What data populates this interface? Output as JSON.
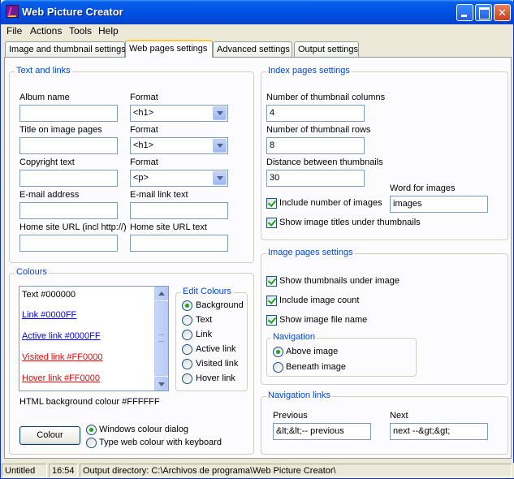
{
  "window": {
    "title": "Web Picture Creator",
    "icon": "app-icon",
    "controls": [
      "minimize-icon",
      "maximize-icon",
      "close-icon"
    ]
  },
  "menu": [
    "File",
    "Actions",
    "Tools",
    "Help"
  ],
  "tabs": [
    {
      "label": "Image and thumbnail settings",
      "active": false
    },
    {
      "label": "Web pages settings",
      "active": true
    },
    {
      "label": "Advanced settings",
      "active": false
    },
    {
      "label": "Output settings",
      "active": false
    }
  ],
  "text_links": {
    "title": "Text and links",
    "album_name_label": "Album name",
    "album_name_value": "",
    "format_label": "Format",
    "album_format": "<h1>",
    "title_label": "Title on image pages",
    "title_value": "",
    "title_format": "<h1>",
    "copyright_label": "Copyright text",
    "copyright_value": "",
    "copyright_format": "<p>",
    "email_label": "E-mail address",
    "email_value": "",
    "email_link_label": "E-mail link text",
    "email_link_value": "",
    "home_url_label": "Home site URL (incl http://)",
    "home_url_value": "",
    "home_url_text_label": "Home site URL text",
    "home_url_text_value": ""
  },
  "colours": {
    "title": "Colours",
    "list": [
      {
        "label": "Text #000000",
        "color": "#000000",
        "link": false
      },
      {
        "label": "Link #0000FF",
        "color": "#0000FF",
        "link": true
      },
      {
        "label": "Active link #0000FF",
        "color": "#0000FF",
        "link": true
      },
      {
        "label": "Visited link #FF0000",
        "color": "#FF0000",
        "link": true
      },
      {
        "label": "Hover link #FF0000",
        "color": "#FF0000",
        "link": true
      }
    ],
    "edit_title": "Edit Colours",
    "edit_options": [
      {
        "label": "Background",
        "checked": true
      },
      {
        "label": "Text",
        "checked": false
      },
      {
        "label": "Link",
        "checked": false
      },
      {
        "label": "Active link",
        "checked": false
      },
      {
        "label": "Visited link",
        "checked": false
      },
      {
        "label": "Hover link",
        "checked": false
      }
    ],
    "background_text": "HTML background colour #FFFFFF",
    "colour_button": "Colour",
    "dialog_options": [
      {
        "label": "Windows colour dialog",
        "checked": true
      },
      {
        "label": "Type web colour with keyboard",
        "checked": false
      }
    ]
  },
  "index": {
    "title": "Index pages settings",
    "columns_label": "Number of thumbnail columns",
    "columns_value": "4",
    "rows_label": "Number of thumbnail rows",
    "rows_value": "8",
    "distance_label": "Distance between thumbnails",
    "distance_value": "30",
    "include_number_label": "Include number of images",
    "include_number_checked": true,
    "word_label": "Word for images",
    "word_value": "images",
    "show_titles_label": "Show image titles under thumbnails",
    "show_titles_checked": true
  },
  "image_pages": {
    "title": "Image pages settings",
    "show_thumbs_label": "Show thumbnails under image",
    "include_count_label": "Include image count",
    "show_filename_label": "Show image file name",
    "navigation_title": "Navigation",
    "above_label": "Above image",
    "above_checked": true,
    "beneath_label": "Beneath image",
    "beneath_checked": false
  },
  "nav_links": {
    "title": "Navigation links",
    "previous_label": "Previous",
    "previous_value": "&lt;&lt;-- previous",
    "next_label": "Next",
    "next_value": "next --&gt;&gt;"
  },
  "status": {
    "file": "Untitled",
    "time": "16:54",
    "output": "Output directory: C:\\Archivos de programa\\Web Picture Creator\\"
  }
}
